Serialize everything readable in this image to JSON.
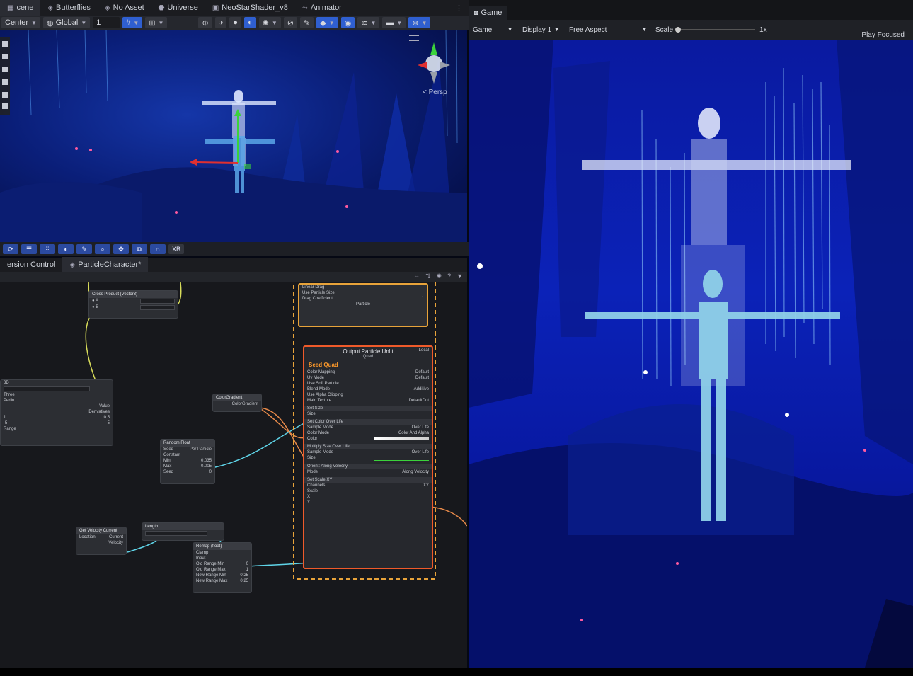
{
  "top_tabs": [
    {
      "label": "cene",
      "icon": "scene-icon"
    },
    {
      "label": "Butterflies",
      "icon": "unity-logo-icon"
    },
    {
      "label": "No Asset",
      "icon": "unity-logo-icon"
    },
    {
      "label": "Universe",
      "icon": "asset-icon"
    },
    {
      "label": "NeoStarShader_v8",
      "icon": "shader-icon"
    },
    {
      "label": "Animator",
      "icon": "animator-icon"
    }
  ],
  "scene_toolbar": {
    "pivot": "Center",
    "space": "Global",
    "grid_value": "1"
  },
  "scene": {
    "persp_label": "< Persp",
    "bottom_xb": "XB"
  },
  "graph_tabs": {
    "version_control": "ersion Control",
    "particle_character": "ParticleCharacter*"
  },
  "game": {
    "tab": "Game",
    "mode": "Game",
    "display": "Display 1",
    "aspect": "Free Aspect",
    "scale_label": "Scale",
    "scale_value": "1x",
    "play_mode": "Play Focused"
  },
  "nodes": {
    "cross_product": "Cross Product (Vector3)",
    "color_gradient": "ColorGradient",
    "color_gradient_out": "ColorGradient",
    "random_float": "Random Float",
    "random_seed": "Seed",
    "random_seed_value": "Per Particle",
    "random_constant": "Constant",
    "random_min": "Min",
    "random_min_value": "0.035",
    "random_max": "Max",
    "random_max_value": "-0.005",
    "random_seed2": "Seed",
    "random_seed2_value": "0",
    "get_velocity": "Get Velocity",
    "get_velocity_mode": "Current",
    "location": "Location",
    "location_value": "Current",
    "velocity": "Velocity",
    "length": "Length",
    "remap": "Remap (float)",
    "clamp": "Clamp",
    "input": "Input",
    "old_range_min": "Old Range Min",
    "old_range_max": "Old Range Max",
    "new_range_min": "New Range Min",
    "new_range_max": "New Range Max",
    "old_min_value": "0",
    "old_max_value": "1",
    "new_min_value": "0.25",
    "new_max_value": "0.25",
    "three": "Three",
    "perlin": "Perlin",
    "value": "Value",
    "derivatives": "Derivatives",
    "left_3d": "3D",
    "val_1": "1",
    "val_05": "0.5",
    "range": "Range",
    "neg5": "-5",
    "five": "5"
  },
  "context": {
    "linear_drag": "Linear Drag",
    "use_particle_size": "Use Particle Size",
    "drag_coefficient": "Drag Coefficient",
    "drag_coefficient_value": "1",
    "particle_link": "Particle",
    "output_title": "Output Particle Unlit",
    "output_subtitle": "Quad",
    "local": "Local",
    "seed_quad": "Seed Quad",
    "color_mapping": "Color Mapping",
    "color_mapping_value": "Default",
    "uv_mode": "Uv Mode",
    "uv_mode_value": "Default",
    "use_soft_particle": "Use Soft Particle",
    "blend_mode": "Blend Mode",
    "blend_mode_value": "Additive",
    "use_alpha_clipping": "Use Alpha Clipping",
    "main_texture": "Main Texture",
    "main_texture_value": "DefaultDot",
    "set_size": "Set Size",
    "size": "Size",
    "set_color_over_life": "Set Color Over Life",
    "sample_mode": "Sample Mode",
    "sample_mode_value": "Over Life",
    "color_mode": "Color Mode",
    "color_mode_value": "Color And Alpha",
    "color": "Color",
    "multiply_size": "Multiply Size Over Life",
    "sample_mode2": "Sample Mode",
    "sample_mode2_value": "Over Life",
    "size2": "Size",
    "orient": "Orient: Along Velocity",
    "mode": "Mode",
    "mode_value": "Along Velocity",
    "set_scale": "Set Scale.XY",
    "channels": "Channels",
    "channels_value": "XY",
    "scale": "Scale",
    "x": "X",
    "y": "Y"
  },
  "colors": {
    "context_border": "#e8a33a",
    "output_border": "#ef5a2a",
    "edge_yellow": "#d8dc5a",
    "edge_cyan": "#5fd4e8",
    "edge_orange": "#e88a4a",
    "accent_blue": "#2f5fd0"
  }
}
